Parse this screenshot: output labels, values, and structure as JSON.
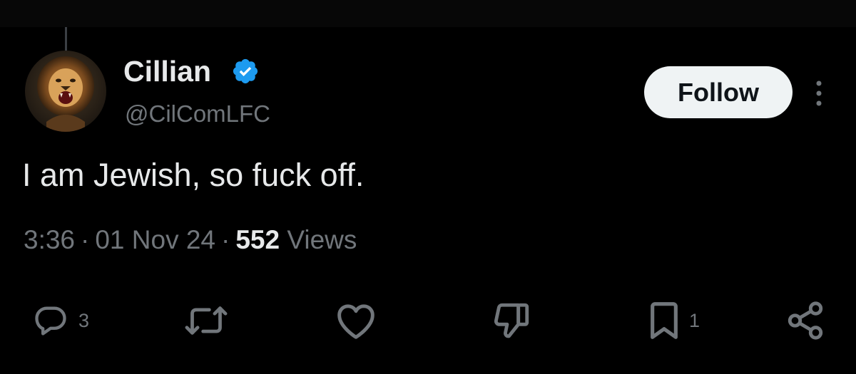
{
  "author": {
    "display_name": "Cillian",
    "handle": "@CilComLFC",
    "avatar_icon": "lion-avatar",
    "verified_icon": "verified-badge-icon"
  },
  "follow_button": {
    "label": "Follow"
  },
  "more_icon": "more-vertical-icon",
  "tweet": {
    "text": "I am Jewish, so fuck off.",
    "time": "3:36",
    "date": "01 Nov 24",
    "separator": "·",
    "views_count": "552",
    "views_label": "Views"
  },
  "actions": {
    "reply": {
      "icon": "reply-icon",
      "count": "3"
    },
    "repost": {
      "icon": "repost-icon"
    },
    "like": {
      "icon": "heart-icon"
    },
    "dislike": {
      "icon": "thumbs-down-icon"
    },
    "bookmark": {
      "icon": "bookmark-icon",
      "count": "1"
    },
    "share": {
      "icon": "share-icon"
    }
  },
  "colors": {
    "background": "#000000",
    "primary_text": "#e7e9ea",
    "secondary_text": "#71767b",
    "verified_blue": "#1d9bf0",
    "follow_button_bg": "#eff3f4"
  }
}
